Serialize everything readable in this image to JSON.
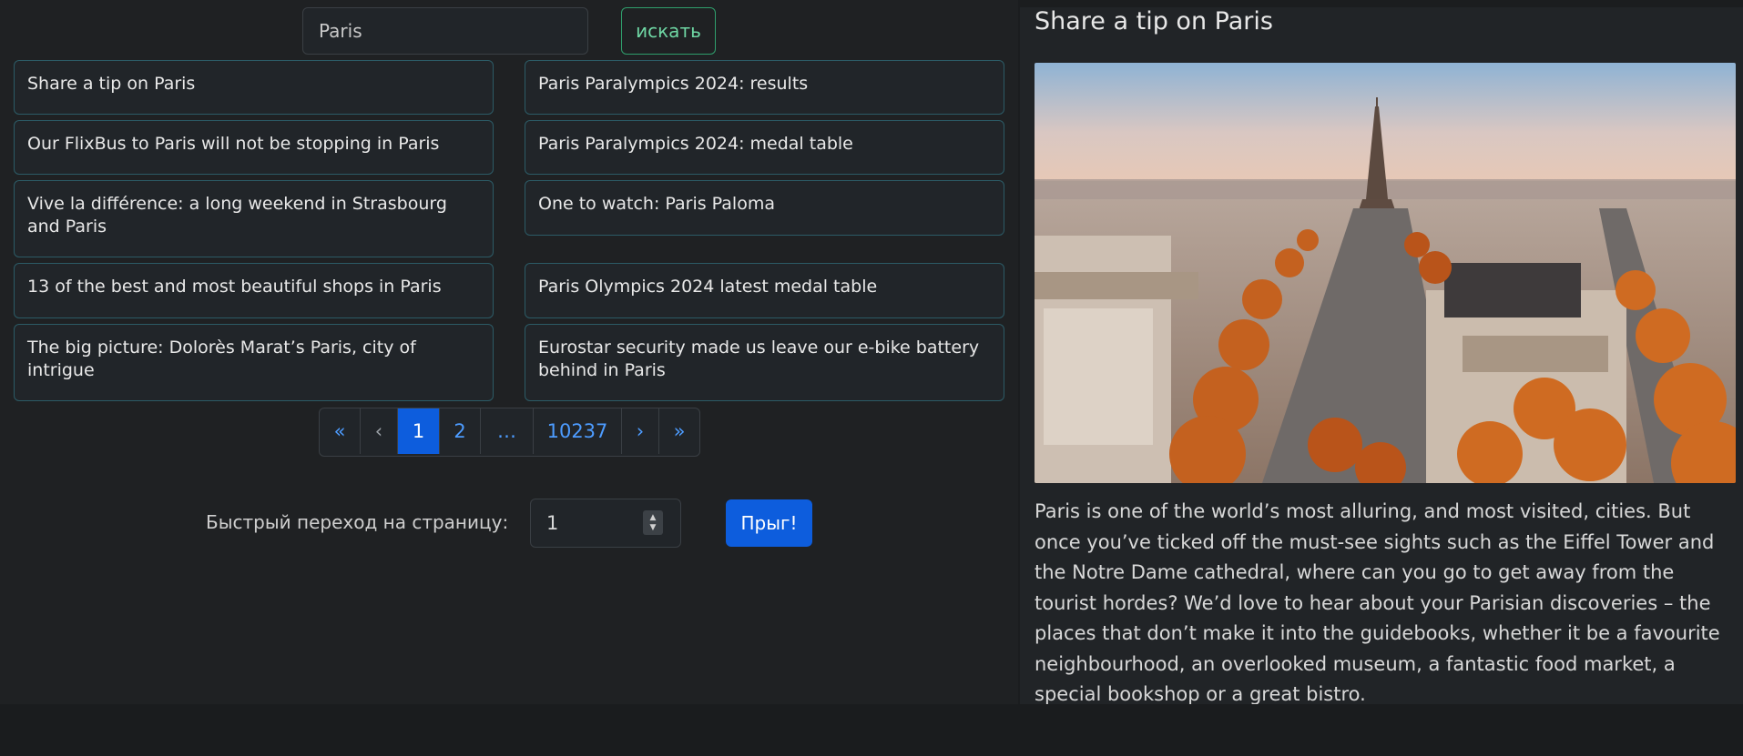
{
  "search": {
    "value": "Paris",
    "button_label": "искать"
  },
  "results": [
    "Share a tip on Paris",
    "Paris Paralympics 2024: results",
    "Our FlixBus to Paris will not be stopping in Paris",
    "Paris Paralympics 2024: medal table",
    "Vive la différence: a long weekend in Strasbourg and Paris",
    "One to watch: Paris Paloma",
    "13 of the best and most beautiful shops in Paris",
    "Paris Olympics 2024 latest medal table",
    "The big picture: Dolorès Marat’s Paris, city of intrigue",
    "Eurostar security made us leave our e-bike battery behind in Paris"
  ],
  "pagination": {
    "first": "«",
    "prev": "‹",
    "pages": [
      "1",
      "2",
      "…",
      "10237"
    ],
    "active": "1",
    "next": "›",
    "last": "»"
  },
  "jump": {
    "label": "Быстрый переход на страницу:",
    "value": "1",
    "button_label": "Прыг!"
  },
  "article": {
    "title": "Share a tip on Paris",
    "body": "Paris is one of the world’s most alluring, and most visited, cities. But once you’ve ticked off the must-see sights such as the Eiffel Tower and the Notre Dame cathedral, where can you go to get away from the tourist hordes? We’d love to hear about your Parisian discoveries – the places that don’t make it into the guidebooks, whether it be a favourite neighbourhood, an overlooked museum, a fantastic food market, a special bookshop or a great bistro."
  },
  "colors": {
    "accent_blue": "#0d5ddd",
    "search_green": "#2f9e6c",
    "card_border": "#2c5b66"
  }
}
